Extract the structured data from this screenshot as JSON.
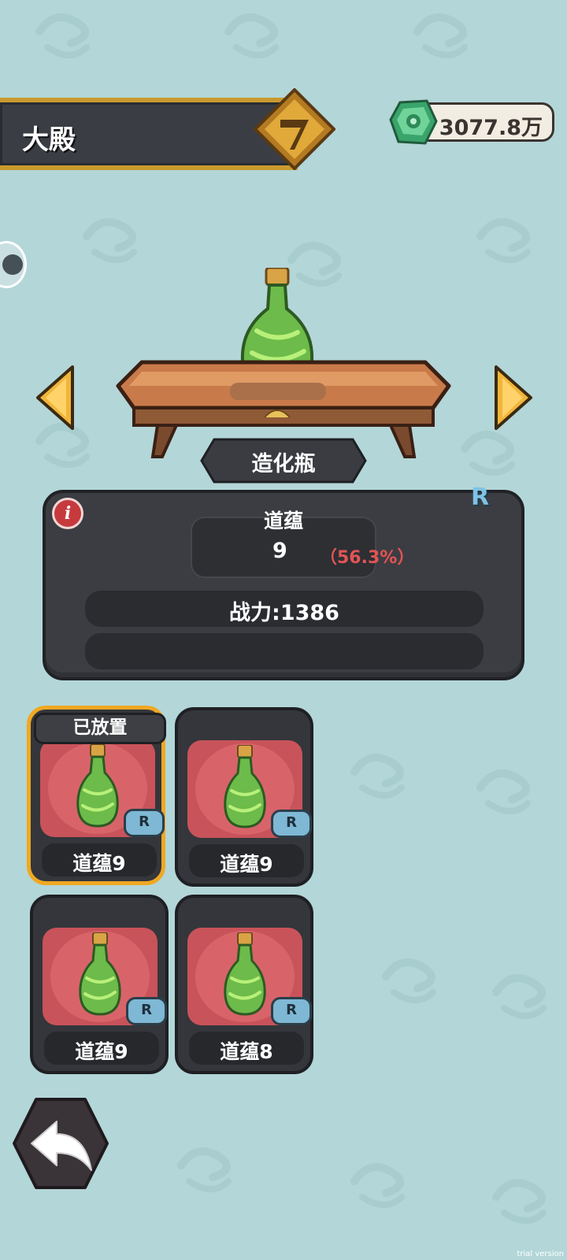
{
  "header": {
    "title": "大殿"
  },
  "currency": {
    "icon": "jade-gem-icon",
    "value": "3077.8万"
  },
  "showcase": {
    "item_name": "造化瓶",
    "rarity": "R",
    "stat_label": "道蕴",
    "stat_level": "9",
    "stat_percent": "（56.3%）",
    "power_text": "战力:1386"
  },
  "inventory": {
    "cards": [
      {
        "label": "道蕴9",
        "rarity": "R",
        "tag": "已放置",
        "selected": true
      },
      {
        "label": "道蕴9",
        "rarity": "R",
        "selected": false
      },
      {
        "label": "道蕴9",
        "rarity": "R",
        "selected": false
      },
      {
        "label": "道蕴8",
        "rarity": "R",
        "selected": false
      }
    ]
  },
  "colors": {
    "background": "#b3d6d8",
    "panel": "#3b3d42",
    "accent_gold": "#c99a2e",
    "selected_border": "#f0a822",
    "percent_red": "#e25454",
    "rarity_blue": "#7fc2e3"
  },
  "watermark": "trial version"
}
